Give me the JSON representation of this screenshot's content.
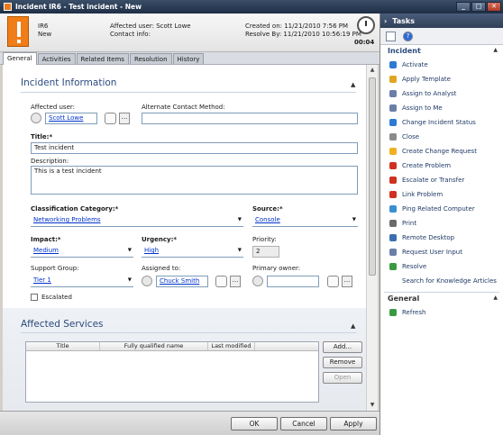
{
  "window": {
    "title": "Incident IR6 - Test incident - New"
  },
  "header": {
    "id": "IR6",
    "status": "New",
    "affected_user": "Affected user: Scott Lowe",
    "contact_info": "Contact info:",
    "created_on": "Created on: 11/21/2010 7:56 PM",
    "resolve_by": "Resolve By: 11/21/2010 10:56:19 PM",
    "timer": "00:04"
  },
  "tabs": [
    "General",
    "Activities",
    "Related Items",
    "Resolution",
    "History"
  ],
  "incident_info": {
    "title": "Incident Information",
    "affected_user_label": "Affected user:",
    "affected_user_value": "Scott Lowe",
    "alternate_contact_label": "Alternate Contact Method:",
    "alternate_contact_value": "",
    "title_label": "Title:*",
    "title_value": "Test incident",
    "description_label": "Description:",
    "description_value": "This is a test incident",
    "classification_label": "Classification Category:*",
    "classification_value": "Networking Problems",
    "source_label": "Source:*",
    "source_value": "Console",
    "impact_label": "Impact:*",
    "impact_value": "Medium",
    "urgency_label": "Urgency:*",
    "urgency_value": "High",
    "priority_label": "Priority:",
    "priority_value": "2",
    "support_group_label": "Support Group:",
    "support_group_value": "Tier 1",
    "assigned_to_label": "Assigned to:",
    "assigned_to_value": "Chuck Smith",
    "primary_owner_label": "Primary owner:",
    "primary_owner_value": "",
    "escalated_label": "Escalated",
    "browse": "..."
  },
  "affected_services": {
    "title": "Affected Services",
    "columns": [
      "Title",
      "Fully qualified name",
      "Last modified"
    ],
    "add": "Add...",
    "remove": "Remove",
    "open": "Open"
  },
  "footer": {
    "ok": "OK",
    "cancel": "Cancel",
    "apply": "Apply"
  },
  "tasks": {
    "title": "Tasks",
    "incident_group": "Incident",
    "items": [
      {
        "label": "Activate",
        "color": "#2b7bd4"
      },
      {
        "label": "Apply Template",
        "color": "#e0a520"
      },
      {
        "label": "Assign to Analyst",
        "color": "#6a7fa8"
      },
      {
        "label": "Assign to Me",
        "color": "#6a7fa8"
      },
      {
        "label": "Change Incident Status",
        "color": "#2b7bd4"
      },
      {
        "label": "Close",
        "color": "#8a8a8a"
      },
      {
        "label": "Create Change Request",
        "color": "#f0b020"
      },
      {
        "label": "Create Problem",
        "color": "#d03020"
      },
      {
        "label": "Escalate or Transfer",
        "color": "#d03020"
      },
      {
        "label": "Link Problem",
        "color": "#d03020"
      },
      {
        "label": "Ping Related Computer",
        "color": "#3a8fd0"
      },
      {
        "label": "Print",
        "color": "#6a6a6a"
      },
      {
        "label": "Remote Desktop",
        "color": "#3a6fb0"
      },
      {
        "label": "Request User Input",
        "color": "#6a7fa8"
      },
      {
        "label": "Resolve",
        "color": "#3a9a40"
      },
      {
        "label": "Search for Knowledge Articles",
        "color": "#ffffff"
      }
    ],
    "general_group": "General",
    "refresh": "Refresh"
  }
}
